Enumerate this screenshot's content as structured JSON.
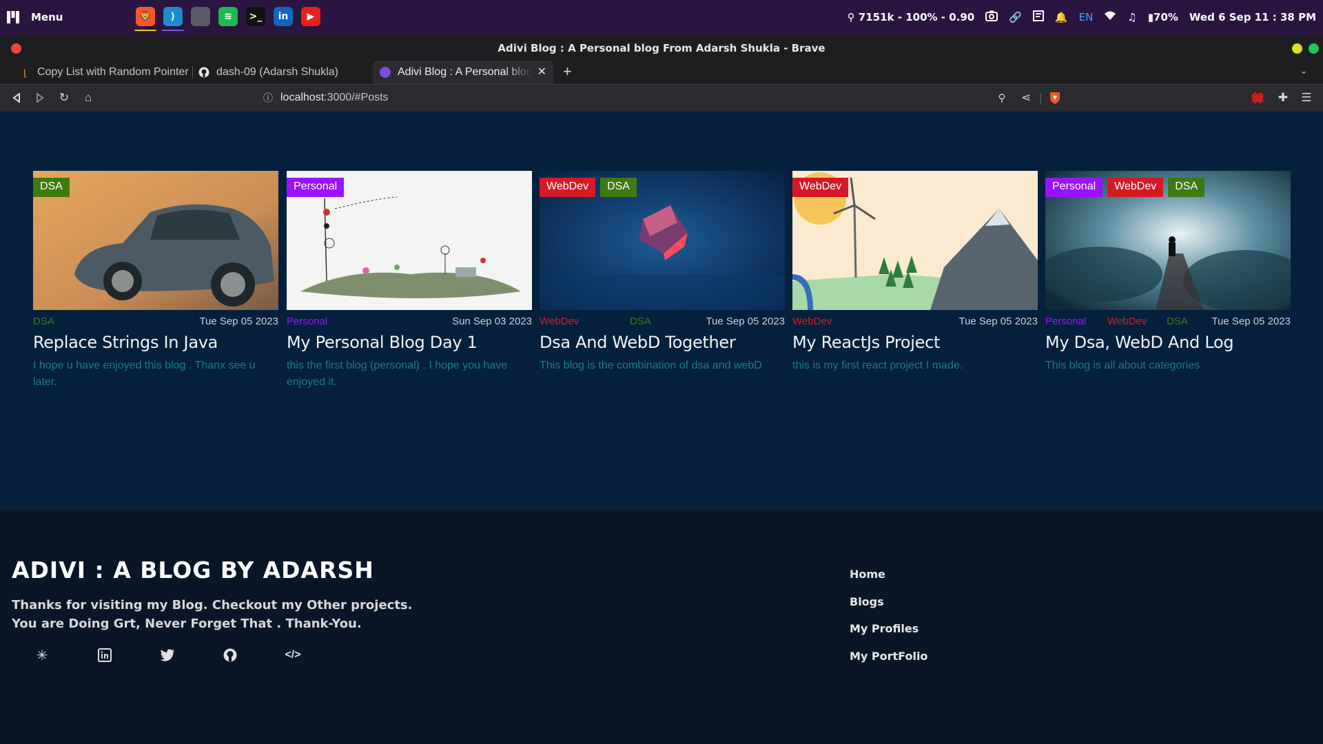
{
  "os_bar": {
    "menu_label": "Menu",
    "dock_apps": [
      {
        "icon": "brave-icon",
        "color": "#fb542b",
        "glyph": "🦁",
        "indicator": "#f2c624"
      },
      {
        "icon": "vscode-icon",
        "color": "#1f8ad2",
        "glyph": "⟩",
        "indicator": "#7c5cd8"
      },
      {
        "icon": "files-icon",
        "color": "#5b5b66",
        "glyph": "",
        "indicator": ""
      },
      {
        "icon": "spotify-icon",
        "color": "#1db954",
        "glyph": "≋",
        "indicator": ""
      },
      {
        "icon": "terminal-icon",
        "color": "#111111",
        "glyph": ">_",
        "indicator": ""
      },
      {
        "icon": "linkedin-icon",
        "color": "#0a66c2",
        "glyph": "in",
        "indicator": ""
      },
      {
        "icon": "youtube-icon",
        "color": "#e62117",
        "glyph": "▶",
        "indicator": ""
      }
    ],
    "location": "7151k - 100% - 0.90",
    "language": "EN",
    "battery": "70%",
    "clock": "Wed  6 Sep 11 : 38 PM"
  },
  "window": {
    "title": "Adivi Blog : A Personal blog From Adarsh Shukla - Brave"
  },
  "tabs": [
    {
      "label": "Copy List with Random Pointer",
      "icon": "leetcode-icon"
    },
    {
      "label": "dash-09 (Adarsh Shukla)",
      "icon": "github-icon"
    },
    {
      "label": "Adivi Blog : A Personal blog From Adarsh Shukla",
      "icon": "site-icon"
    }
  ],
  "address": {
    "host": "localhost",
    "path": ":3000/#Posts"
  },
  "colors": {
    "DSA": "#3d7a12",
    "Personal": "#9b12ff",
    "WebDev": "#d61a25",
    "desc": "#1c7d86"
  },
  "posts": [
    {
      "tags": [
        "DSA"
      ],
      "meta_tags": [
        "DSA"
      ],
      "date": "Tue Sep 05 2023",
      "title": "Replace Strings In Java",
      "desc": "I hope u have enjoyed this blog . Thanx see u later.",
      "image": "vintage-car"
    },
    {
      "tags": [
        "Personal"
      ],
      "meta_tags": [
        "Personal"
      ],
      "date": "Sun Sep 03 2023",
      "title": "My Personal Blog Day 1",
      "desc": "this the first blog (personal) . I hope you have enjoyed it.",
      "image": "doodle-island"
    },
    {
      "tags": [
        "WebDev",
        "DSA"
      ],
      "meta_tags": [
        "WebDev",
        "DSA"
      ],
      "date": "Tue Sep 05 2023",
      "title": "Dsa And WebD Together",
      "desc": "This blog is the combination of dsa and webD",
      "image": "glass-cube"
    },
    {
      "tags": [
        "WebDev"
      ],
      "meta_tags": [
        "WebDev"
      ],
      "date": "Tue Sep 05 2023",
      "title": "My ReactJs Project",
      "desc": "this is my first react project I made.",
      "image": "windmill-landscape"
    },
    {
      "tags": [
        "Personal",
        "WebDev",
        "DSA"
      ],
      "meta_tags": [
        "Personal",
        "WebDev",
        "DSA"
      ],
      "date": "Tue Sep 05 2023",
      "title": "My Dsa, WebD And Log",
      "desc": "This blog is all about categories",
      "image": "cloud-walker"
    }
  ],
  "footer": {
    "heading": "ADIVI : A BLOG BY ADARSH",
    "text": "Thanks for visiting my Blog. Checkout my Other projects. You are Doing Grt, Never Forget That . Thank-You.",
    "social": [
      "linktree-icon",
      "linkedin-icon",
      "twitter-icon",
      "github-icon",
      "code-icon"
    ],
    "links": [
      "Home",
      "Blogs",
      "My Profiles",
      "My PortFolio"
    ]
  }
}
